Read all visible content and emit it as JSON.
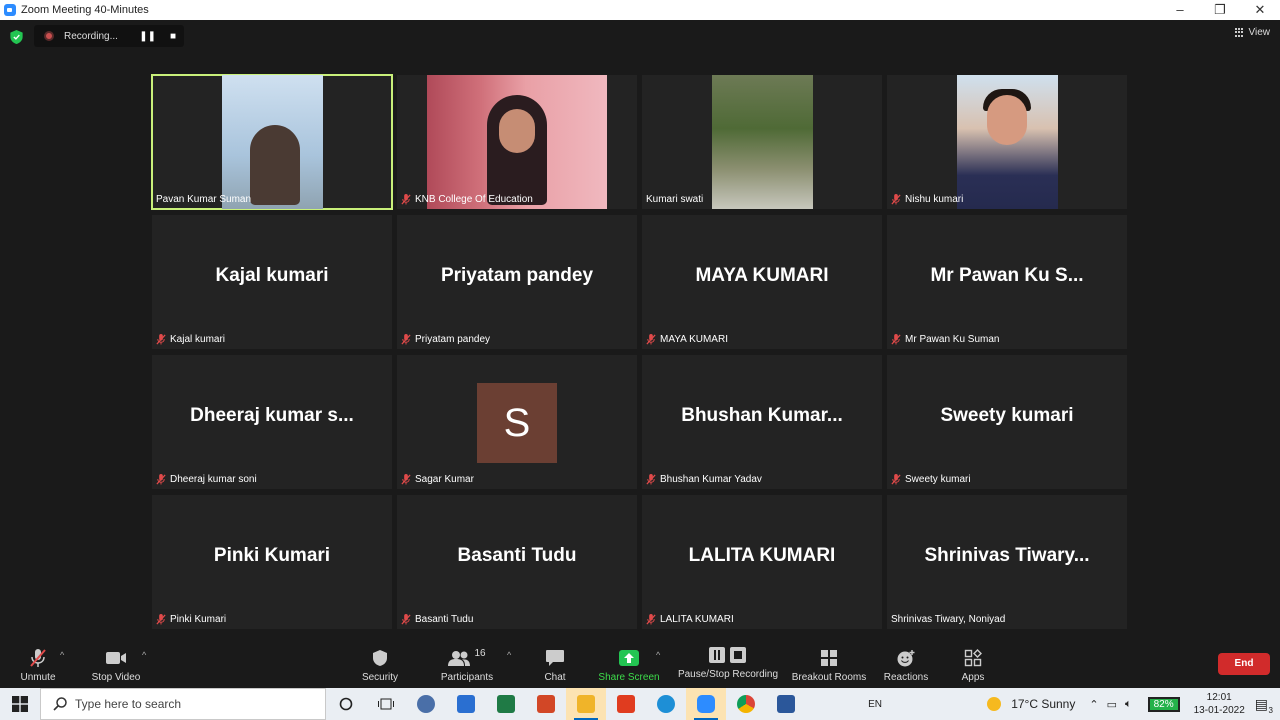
{
  "window": {
    "title": "Zoom Meeting 40-Minutes",
    "minimize": "–",
    "maximize": "❐",
    "close": "✕"
  },
  "recording": {
    "status": "Recording...",
    "pause_glyph": "❚❚",
    "stop_glyph": "■"
  },
  "view_label": "View",
  "tiles": [
    {
      "big": "",
      "label": "Pavan Kumar Suman",
      "muted": false,
      "video": true
    },
    {
      "big": "",
      "label": "KNB College Of Education",
      "muted": true,
      "video": true
    },
    {
      "big": "",
      "label": "Kumari swati",
      "muted": false,
      "video": true
    },
    {
      "big": "",
      "label": "Nishu kumari",
      "muted": true,
      "video": true
    },
    {
      "big": "Kajal kumari",
      "label": "Kajal kumari",
      "muted": true
    },
    {
      "big": "Priyatam pandey",
      "label": "Priyatam pandey",
      "muted": true
    },
    {
      "big": "MAYA KUMARI",
      "label": "MAYA KUMARI",
      "muted": true
    },
    {
      "big": "Mr  Pawan Ku S...",
      "label": "Mr  Pawan Ku Suman",
      "muted": true
    },
    {
      "big": "Dheeraj  kumar  s...",
      "label": "Dheeraj kumar soni",
      "muted": true
    },
    {
      "big": "",
      "avatar": "S",
      "label": "Sagar Kumar",
      "muted": true
    },
    {
      "big": "Bhushan  Kumar...",
      "label": "Bhushan Kumar Yadav",
      "muted": true
    },
    {
      "big": "Sweety kumari",
      "label": "Sweety kumari",
      "muted": true
    },
    {
      "big": "Pinki Kumari",
      "label": "Pinki Kumari",
      "muted": true
    },
    {
      "big": "Basanti Tudu",
      "label": "Basanti Tudu",
      "muted": true
    },
    {
      "big": "LALITA KUMARI",
      "label": "LALITA KUMARI",
      "muted": true
    },
    {
      "big": "Shrinivas  Tiwary...",
      "label": "Shrinivas Tiwary, Noniyad",
      "muted": false
    }
  ],
  "toolbar": {
    "unmute": "Unmute",
    "stop_video": "Stop Video",
    "security": "Security",
    "participants": "Participants",
    "participant_count": "16",
    "chat": "Chat",
    "share_screen": "Share Screen",
    "pause_stop_recording": "Pause/Stop Recording",
    "breakout_rooms": "Breakout Rooms",
    "reactions": "Reactions",
    "apps": "Apps",
    "end": "End",
    "caret": "^"
  },
  "taskbar": {
    "search_placeholder": "Type here to search",
    "weather": "17°C  Sunny",
    "lang": "EN",
    "battery": "82%",
    "time": "12:01",
    "date": "13-01-2022",
    "notifications": "3"
  },
  "colors": {
    "active_speaker": "#c9f07a",
    "end_button": "#d12b2b",
    "share_green": "#3ddc4b",
    "mute_red": "#e04a4a"
  }
}
